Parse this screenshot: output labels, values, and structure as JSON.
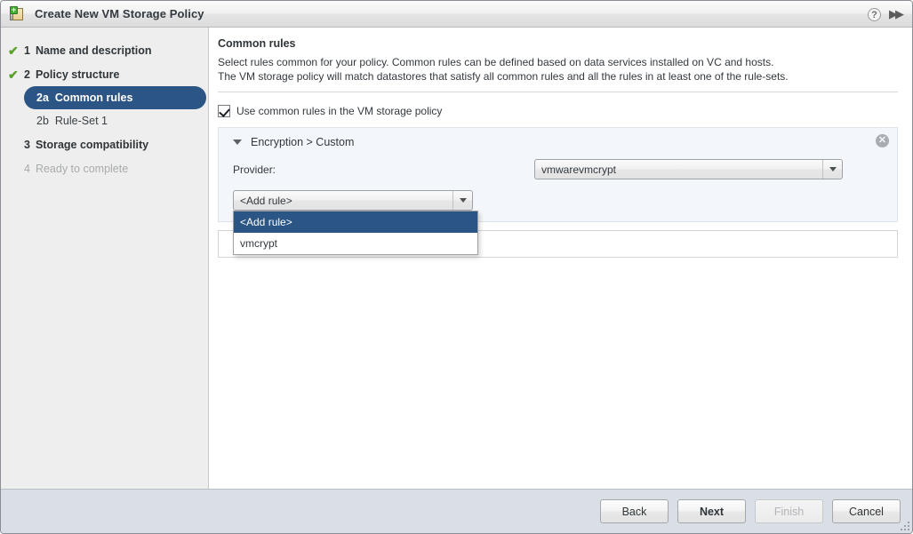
{
  "window": {
    "title": "Create New VM Storage Policy",
    "icon": "new-policy-icon",
    "help_icon": "?",
    "expand_icon": "▶▶"
  },
  "sidebar": {
    "steps": [
      {
        "check": "✔",
        "num": "1",
        "label": "Name and description",
        "state": "done"
      },
      {
        "check": "✔",
        "num": "2",
        "label": "Policy structure",
        "state": "done"
      }
    ],
    "substeps": [
      {
        "num": "2a",
        "label": "Common rules",
        "state": "active"
      },
      {
        "num": "2b",
        "label": "Rule-Set 1",
        "state": "normal"
      }
    ],
    "steps_after": [
      {
        "check": "",
        "num": "3",
        "label": "Storage compatibility",
        "state": "normal"
      },
      {
        "check": "",
        "num": "4",
        "label": "Ready to complete",
        "state": "disabled"
      }
    ]
  },
  "content": {
    "heading": "Common rules",
    "description_line1": "Select rules common for your policy. Common rules can be defined based on data services installed on VC and hosts.",
    "description_line2": "The VM storage policy will match datastores that satisfy all common rules and all the rules in at least one of the rule-sets.",
    "use_common_rules_label": "Use common rules in the VM storage policy",
    "use_common_rules_checked": true,
    "panel": {
      "title": "Encryption > Custom",
      "collapse_icon": "▼",
      "remove_icon": "✕",
      "provider_label": "Provider:",
      "provider_value": "vmwarevmcrypt",
      "add_rule_value": "<Add rule>",
      "add_rule_options": [
        {
          "label": "<Add rule>",
          "selected": true
        },
        {
          "label": "vmcrypt",
          "selected": false
        }
      ]
    }
  },
  "footer": {
    "back": "Back",
    "next": "Next",
    "finish": "Finish",
    "cancel": "Cancel",
    "finish_disabled": true
  },
  "colors": {
    "accent": "#2a5584",
    "check_green": "#5aa02c",
    "panel_bg": "#f3f6fa",
    "sidebar_bg": "#eeeeee",
    "footer_bg": "#dadee5"
  }
}
